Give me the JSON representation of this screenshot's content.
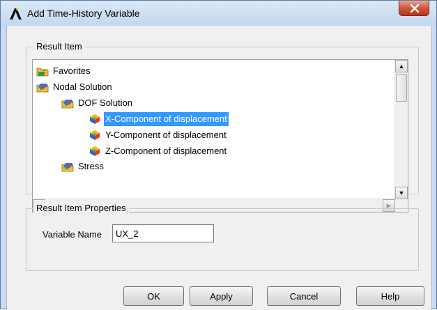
{
  "window": {
    "title": "Add Time-History Variable",
    "logo_icon": "ansys-logo-icon",
    "close_icon": "close-icon"
  },
  "result_item": {
    "legend": "Result Item",
    "tree": [
      {
        "label": "Favorites",
        "icon": "favorites-folder-icon",
        "level": 0,
        "selected": false
      },
      {
        "label": "Nodal Solution",
        "icon": "results-folder-icon",
        "level": 0,
        "selected": false
      },
      {
        "label": "DOF Solution",
        "icon": "results-folder-icon",
        "level": 1,
        "selected": false
      },
      {
        "label": "X-Component of displacement",
        "icon": "result-cube-icon",
        "level": 2,
        "selected": true
      },
      {
        "label": "Y-Component of displacement",
        "icon": "result-cube-icon",
        "level": 2,
        "selected": false
      },
      {
        "label": "Z-Component of displacement",
        "icon": "result-cube-icon",
        "level": 2,
        "selected": false
      },
      {
        "label": "Stress",
        "icon": "results-folder-icon",
        "level": 1,
        "selected": false
      }
    ]
  },
  "properties": {
    "legend": "Result Item Properties",
    "variable_name_label": "Variable Name",
    "variable_name_value": "UX_2"
  },
  "buttons": {
    "ok": "OK",
    "apply": "Apply",
    "cancel": "Cancel",
    "help": "Help"
  },
  "colors": {
    "title_bar": "#c9dcf1",
    "selection": "#3399ff",
    "close_button": "#c94a32"
  }
}
